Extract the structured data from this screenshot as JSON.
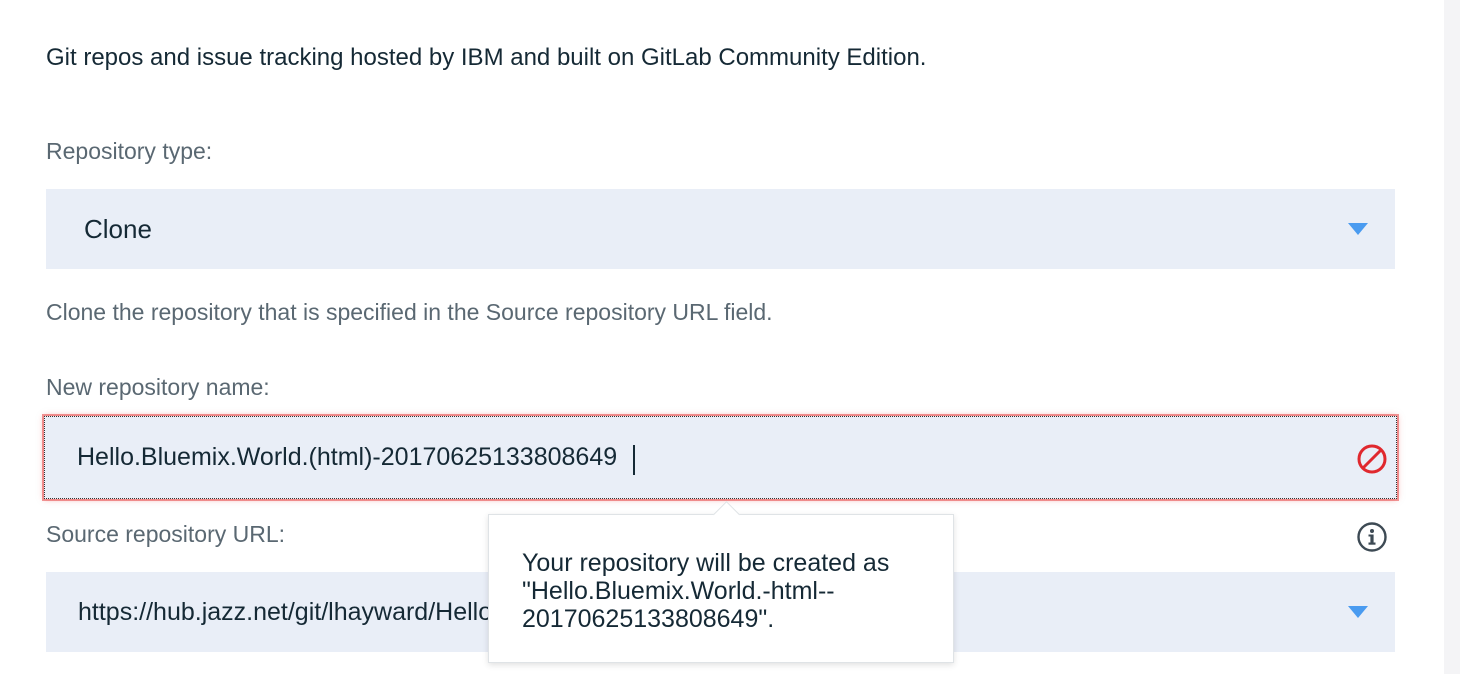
{
  "description": "Git repos and issue tracking hosted by IBM and built on GitLab Community Edition.",
  "repository_type": {
    "label": "Repository type:",
    "value": "Clone",
    "help_text": "Clone the repository that is specified in the Source repository URL field."
  },
  "new_repository_name": {
    "label": "New repository name:",
    "value": "Hello.Bluemix.World.(html)-20170625133808649"
  },
  "source_repository_url": {
    "label": "Source repository URL:",
    "value": "https://hub.jazz.net/git/lhayward/Hello.Bluemix.World.(html)"
  },
  "tooltip": {
    "text": "Your repository will be created as\n\"Hello.Bluemix.World.-html--\n20170625133808649\"."
  },
  "colors": {
    "accent": "#4a9bf0",
    "error": "#e0282e",
    "field_bg": "#e9eef7"
  },
  "icons": {
    "dropdown": "caret-down-icon",
    "error": "no-entry-icon",
    "info": "info-circle-icon"
  }
}
